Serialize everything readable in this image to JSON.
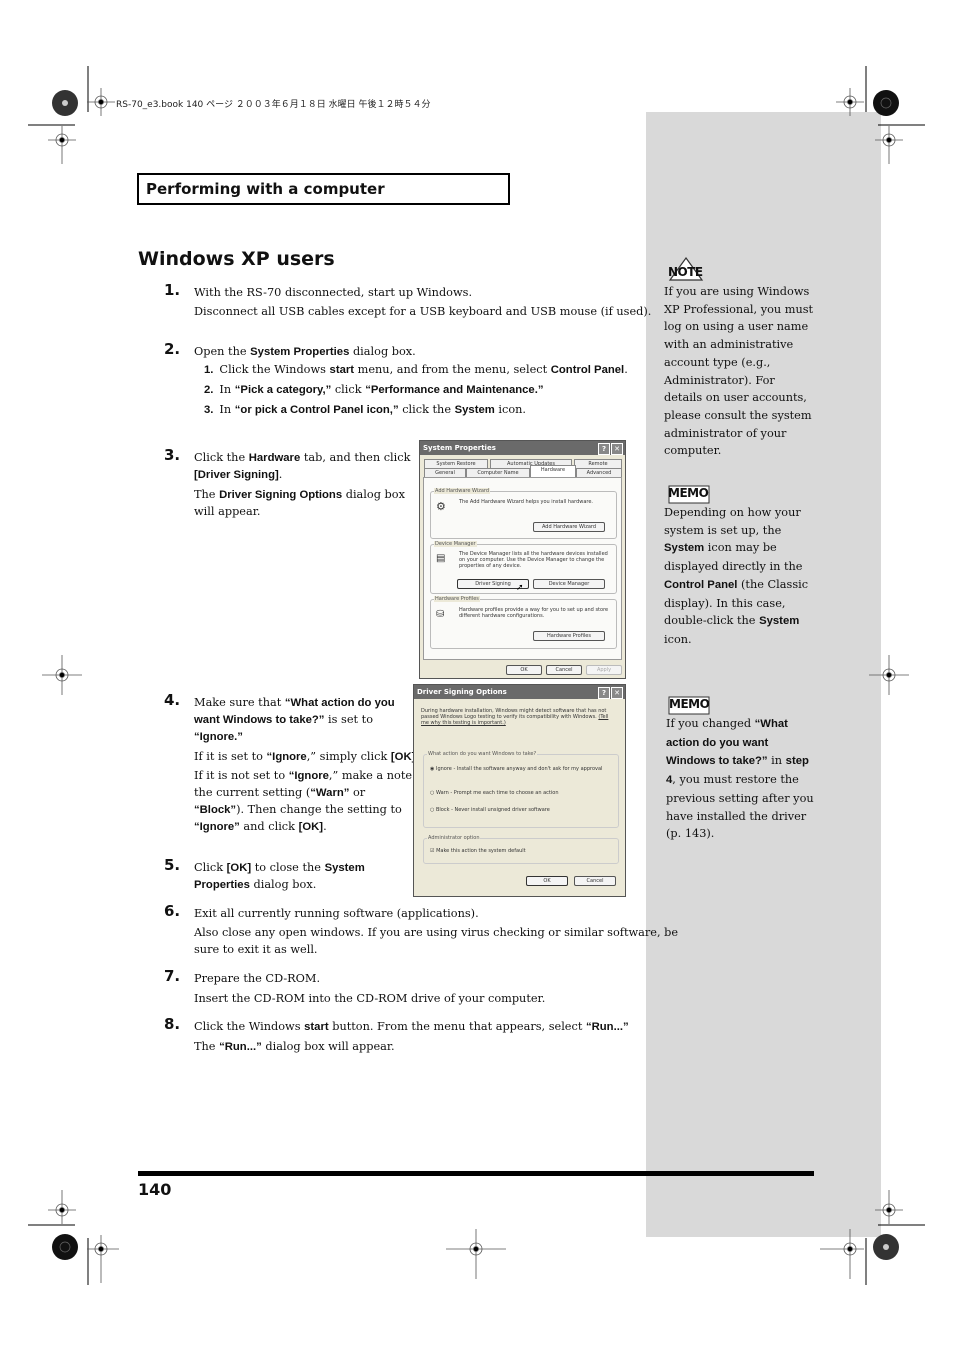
{
  "print_header": "RS-70_e3.book  140 ページ  ２００３年６月１８日  水曜日  午後１２時５４分",
  "section_title": "Performing with a computer",
  "page_title": "Windows XP users",
  "steps": [
    {
      "num": "1.",
      "lines": [
        "With the RS-70 disconnected, start up Windows.",
        "Disconnect all USB cables except for a USB keyboard and USB mouse (if used)."
      ]
    },
    {
      "num": "2.",
      "intro_pre": "Open the ",
      "intro_bold": "System Properties",
      "intro_post": " dialog box.",
      "substeps": [
        {
          "num": "1.",
          "pre": "Click the Windows ",
          "b1": "start",
          "mid": " menu, and from the menu, select ",
          "b2": "Control Panel",
          "post": "."
        },
        {
          "num": "2.",
          "pre": "In ",
          "b1": "“Pick a category,”",
          "mid": " click ",
          "b2": "“Performance and Maintenance.”",
          "post": ""
        },
        {
          "num": "3.",
          "pre": "In ",
          "b1": "“or pick a Control Panel icon,”",
          "mid": " click the ",
          "b2": "System",
          "post": " icon."
        }
      ]
    },
    {
      "num": "3.",
      "l1_pre": "Click the ",
      "l1_b": "Hardware",
      "l1_post": " tab, and then click",
      "l2_b": "[Driver Signing]",
      "l2_post": ".",
      "l3_pre": "The ",
      "l3_b": "Driver Signing Options",
      "l3_post": " dialog box",
      "l4": "will appear."
    },
    {
      "num": "4.",
      "l1_pre": "Make sure that ",
      "l1_b": "“What action do you",
      "l2_b": "want Windows to take?”",
      "l2_post": " is set to",
      "l3_b": "“Ignore.”",
      "p2_pre": "If it is set to ",
      "p2_b": "“Ignore",
      "p2_mid": ",” simply click ",
      "p2_b2": "[OK]",
      "p2_post": ".",
      "p3_pre": "If it is not set to ",
      "p3_b": "“Ignore",
      "p3_post": ",” make a note of",
      "p4_pre": "the current setting (",
      "p4_b": "“Warn”",
      "p4_post": " or",
      "p5_b": "“Block”",
      "p5_post": "). Then change the setting to",
      "p6_b": "“Ignore”",
      "p6_mid": " and click ",
      "p6_b2": "[OK]",
      "p6_post": "."
    },
    {
      "num": "5.",
      "l1_pre": "Click ",
      "l1_b": "[OK]",
      "l1_mid": " to close the ",
      "l1_b2": "System",
      "l2_b": "Properties",
      "l2_post": " dialog box."
    },
    {
      "num": "6.",
      "l1": "Exit all currently running software (applications).",
      "l2": "Also close any open windows. If you are using virus checking or similar software, be",
      "l3": "sure to exit it as well."
    },
    {
      "num": "7.",
      "l1": "Prepare the CD-ROM.",
      "l2": "Insert the CD-ROM into the CD-ROM drive of your computer."
    },
    {
      "num": "8.",
      "l1_pre": "Click the Windows ",
      "l1_b": "start",
      "l1_mid": " button. From the menu that appears, select ",
      "l1_b2": "“Run...”",
      "l2_pre": "The ",
      "l2_b": "“Run...”",
      "l2_post": " dialog box will appear."
    }
  ],
  "system_properties_dialog": {
    "title": "System Properties",
    "help_btn": "?",
    "close_btn": "✕",
    "tabs_row1": [
      "System Restore",
      "Automatic Updates",
      "Remote"
    ],
    "tabs_row2": [
      "General",
      "Computer Name",
      "Hardware",
      "Advanced"
    ],
    "active_tab": "Hardware",
    "groups": [
      {
        "legend": "Add Hardware Wizard",
        "text": "The Add Hardware Wizard helps you install hardware.",
        "buttons": [
          "Add Hardware Wizard"
        ]
      },
      {
        "legend": "Device Manager",
        "text": "The Device Manager lists all the hardware devices installed on your computer. Use the Device Manager to change the properties of any device.",
        "buttons": [
          "Driver Signing",
          "Device Manager"
        ]
      },
      {
        "legend": "Hardware Profiles",
        "text": "Hardware profiles provide a way for you to set up and store different hardware configurations.",
        "buttons": [
          "Hardware Profiles"
        ]
      }
    ],
    "footer_buttons": [
      "OK",
      "Cancel",
      "Apply"
    ]
  },
  "driver_signing_dialog": {
    "title": "Driver Signing Options",
    "help_btn": "?",
    "close_btn": "✕",
    "intro": "During hardware installation, Windows might detect software that has not passed Windows Logo testing to verify its compatibility with Windows.",
    "link": "(Tell me why this testing is important.)",
    "group1_legend": "What action do you want Windows to take?",
    "options": [
      {
        "label": "Ignore - Install the software anyway and don't ask for my approval",
        "selected": true
      },
      {
        "label": "Warn - Prompt me each time to choose an action",
        "selected": false
      },
      {
        "label": "Block - Never install unsigned driver software",
        "selected": false
      }
    ],
    "group2_legend": "Administrator option",
    "checkbox_label": "Make this action the system default",
    "checkbox_checked": true,
    "buttons": [
      "OK",
      "Cancel"
    ]
  },
  "sidebar": {
    "note": {
      "badge": "NOTE",
      "text": "If you are using Windows XP Professional, you must log on using a user name with an administrative account type (e.g., Administrator). For details on user accounts, please consult the system administrator of your computer."
    },
    "memo1": {
      "badge": "MEMO",
      "t1": "Depending on how your system is set up, the ",
      "b1": "System",
      "t2": " icon may be displayed directly in the ",
      "b2": "Control Panel",
      "t3": " (the Classic display). In this case, double-click the ",
      "b3": "System",
      "t4": " icon."
    },
    "memo2": {
      "badge": "MEMO",
      "t1": "If you changed ",
      "b1": "“What action do you want Windows to take?”",
      "t2": " in ",
      "b2": "step 4",
      "t3": ", you must restore the previous setting after you have installed the driver (p. 143)."
    }
  },
  "page_number": "140",
  "colors": {
    "sidebar_bg": "#d9d9d9",
    "text": "#111111"
  }
}
